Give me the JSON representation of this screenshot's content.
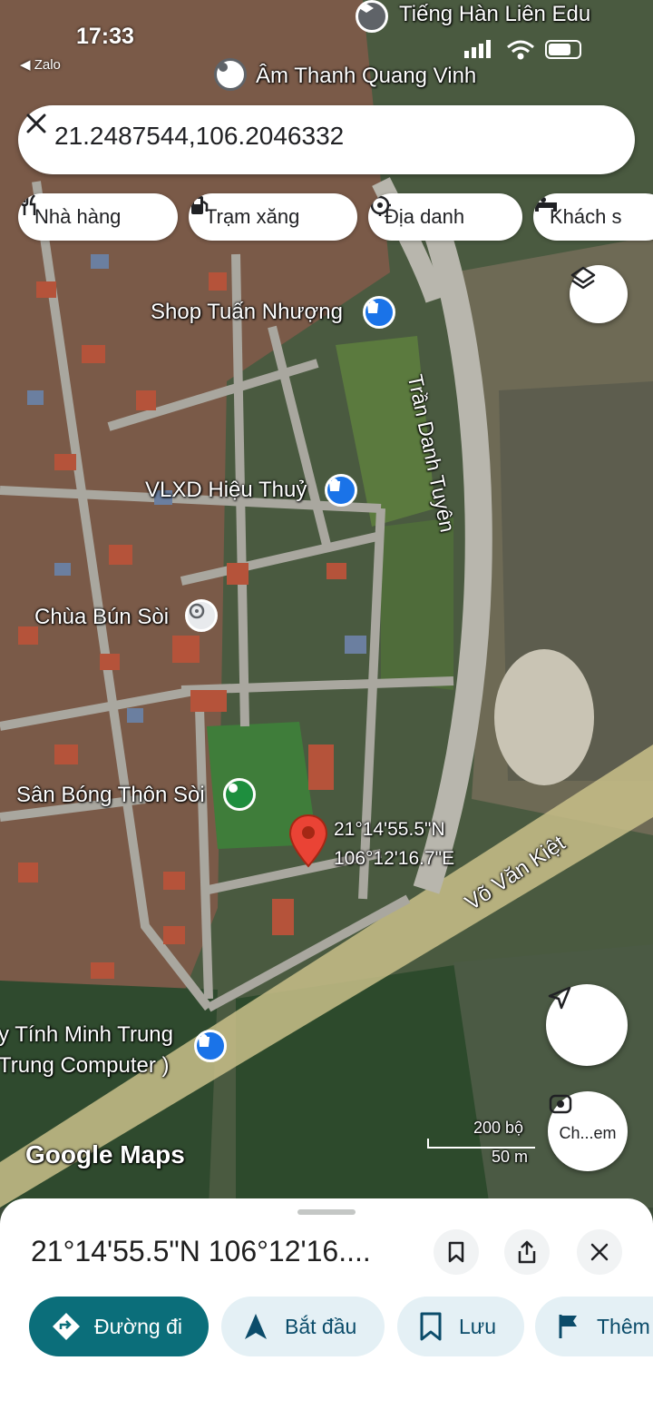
{
  "status_bar": {
    "time": "17:33",
    "back_app": "◀ Zalo"
  },
  "search": {
    "value": "21.2487544,106.2046332"
  },
  "chips": [
    {
      "label": "Nhà hàng",
      "icon": "restaurant-icon"
    },
    {
      "label": "Trạm xăng",
      "icon": "gas-station-icon"
    },
    {
      "label": "Địa danh",
      "icon": "landmark-icon"
    },
    {
      "label": "Khách s",
      "icon": "hotel-icon"
    }
  ],
  "map": {
    "labels": {
      "tieng_han": "Tiếng Hàn Liên Edu",
      "am_thanh": "Âm Thanh Quang Vinh",
      "shop_tuan": "Shop Tuấn Nhượng",
      "tran_danh_tuyen": "Trần Danh Tuyên",
      "vlxd": "VLXD Hiệu Thuỷ",
      "chua": "Chùa Bún Sòi",
      "san_bong": "Sân Bóng Thôn Sòi",
      "pin_lat": "21°14'55.5\"N",
      "pin_lng": "106°12'16.7\"E",
      "vo_van_kiet": "Võ Văn Kiệt",
      "may_tinh_1": "y Tính Minh Trung",
      "may_tinh_2": "Trung Computer )",
      "google_maps": "Google Maps",
      "scale_ft": "200 bộ",
      "scale_m": "50 m"
    },
    "lens_label": "Ch...em"
  },
  "sheet": {
    "title": "21°14'55.5\"N 106°12'16....",
    "actions": [
      {
        "label": "Đường đi",
        "icon": "directions-icon",
        "primary": true
      },
      {
        "label": "Bắt đầu",
        "icon": "navigation-arrow-icon"
      },
      {
        "label": "Lưu",
        "icon": "bookmark-icon"
      },
      {
        "label": "Thêm",
        "icon": "flag-icon"
      }
    ]
  },
  "colors": {
    "accent": "#0b6e7a",
    "pin": "#ea4335",
    "chip_bg": "#e4f0f5"
  }
}
